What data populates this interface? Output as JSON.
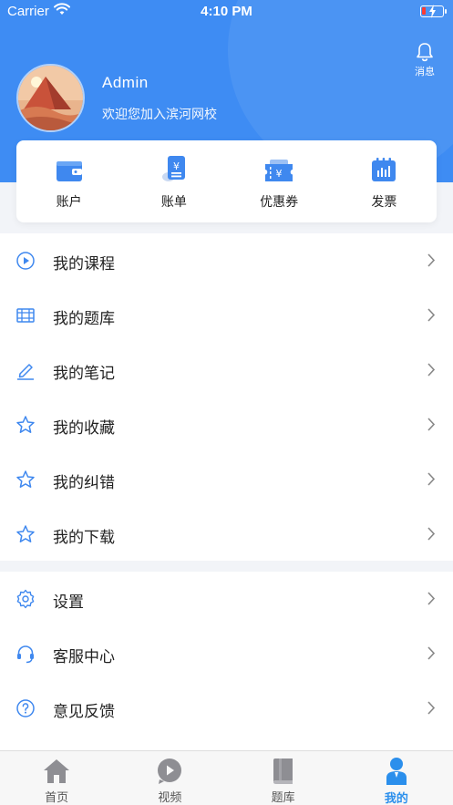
{
  "status_bar": {
    "carrier": "Carrier",
    "time": "4:10 PM"
  },
  "header": {
    "message_label": "消息"
  },
  "profile": {
    "name": "Admin",
    "subtitle": "欢迎您加入滨河网校"
  },
  "quick_actions": [
    {
      "label": "账户",
      "icon": "wallet-icon"
    },
    {
      "label": "账单",
      "icon": "bill-icon"
    },
    {
      "label": "优惠券",
      "icon": "coupon-icon"
    },
    {
      "label": "发票",
      "icon": "invoice-icon"
    }
  ],
  "menu_main": [
    {
      "label": "我的课程",
      "icon": "play-circle-icon"
    },
    {
      "label": "我的题库",
      "icon": "question-bank-icon"
    },
    {
      "label": "我的笔记",
      "icon": "pencil-icon"
    },
    {
      "label": "我的收藏",
      "icon": "star-icon"
    },
    {
      "label": "我的纠错",
      "icon": "star-icon"
    },
    {
      "label": "我的下载",
      "icon": "star-icon"
    }
  ],
  "menu_settings": [
    {
      "label": "设置",
      "icon": "gear-icon"
    },
    {
      "label": "客服中心",
      "icon": "headset-icon"
    },
    {
      "label": "意见反馈",
      "icon": "question-circle-icon"
    }
  ],
  "tabs": [
    {
      "label": "首页",
      "icon": "home-icon",
      "active": false
    },
    {
      "label": "视频",
      "icon": "video-icon",
      "active": false
    },
    {
      "label": "题库",
      "icon": "book-icon",
      "active": false
    },
    {
      "label": "我的",
      "icon": "user-icon",
      "active": true
    }
  ],
  "colors": {
    "primary": "#3e8cf3",
    "accent": "#2b8fec",
    "battery_low": "#ff3b30"
  }
}
